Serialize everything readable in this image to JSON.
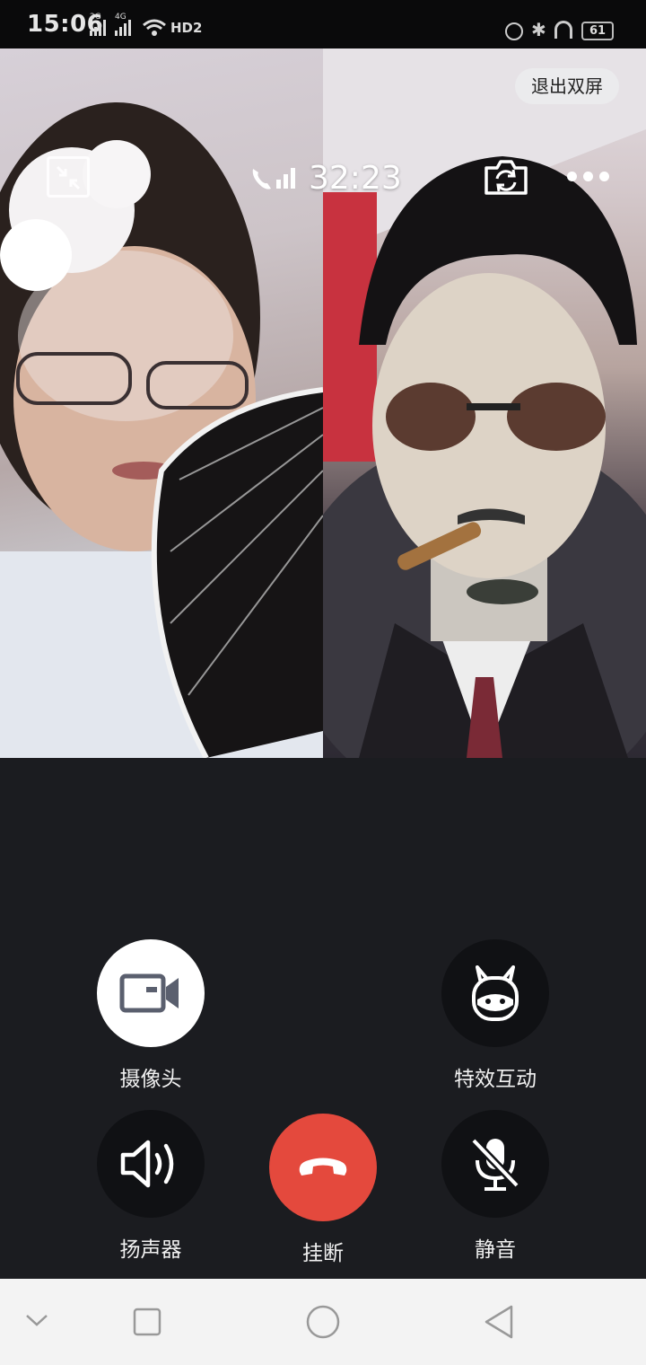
{
  "status_bar": {
    "time": "15:06",
    "net1": "2G",
    "net2": "4G",
    "hd": "HD2",
    "battery": "61"
  },
  "call": {
    "timer": "32:23",
    "exit_dual_screen": "退出双屏"
  },
  "controls": {
    "camera_label": "摄像头",
    "effects_label": "特效互动",
    "speaker_label": "扬声器",
    "hangup_label": "挂断",
    "mute_label": "静音"
  },
  "icons": [
    "minimize-icon",
    "phone-signal-icon",
    "switch-camera-icon",
    "more-icon",
    "camera-icon",
    "effects-icon",
    "speaker-icon",
    "hangup-icon",
    "mic-off-icon",
    "nav-collapse-icon",
    "nav-recents-icon",
    "nav-home-icon",
    "nav-back-icon"
  ],
  "colors": {
    "hangup": "#e4493d",
    "background": "#1b1c20",
    "nav_bar": "#f3f3f3"
  }
}
